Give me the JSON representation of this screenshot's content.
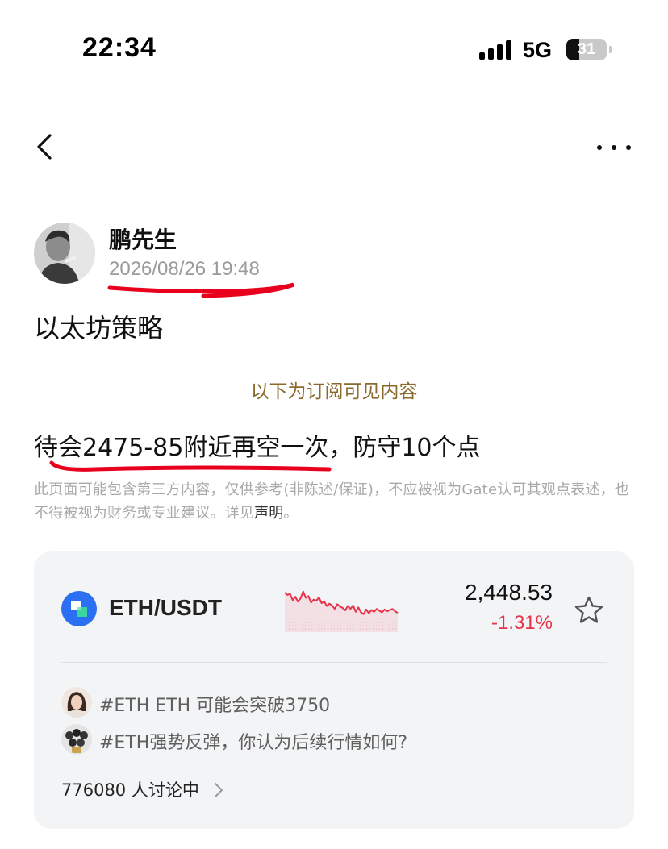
{
  "status_bar": {
    "time": "22:34",
    "network": "5G",
    "battery": "31",
    "battery_level": 0.31
  },
  "nav": {
    "back_icon": "chevron-left-icon",
    "more_icon": "ellipsis-icon"
  },
  "post": {
    "author": "鹏先生",
    "date": "2026/08/26 19:48",
    "title": "以太坊策略",
    "divider_label": "以下为订阅可见内容",
    "content": "待会2475-85附近再空一次，防守10个点",
    "disclaimer_text": "此页面可能包含第三方内容，仅供参考(非陈述/保证)，不应被视为Gate认可其观点表述，也不得被视为财务或专业建议。详见",
    "disclaimer_link": "声明",
    "disclaimer_end": "。",
    "annotation_color": "#e8001c"
  },
  "market_card": {
    "pair": "ETH/USDT",
    "price": "2,448.53",
    "change": "-1.31%",
    "change_color": "#e8334a",
    "sparkline": [
      0.86,
      0.78,
      0.82,
      0.6,
      0.72,
      0.55,
      0.66,
      0.9,
      0.68,
      0.74,
      0.52,
      0.62,
      0.58,
      0.7,
      0.5,
      0.56,
      0.4,
      0.48,
      0.42,
      0.3,
      0.46,
      0.38,
      0.34,
      0.25,
      0.4,
      0.3,
      0.42,
      0.2,
      0.35,
      0.18,
      0.12,
      0.28,
      0.15,
      0.26,
      0.2,
      0.3,
      0.24,
      0.18,
      0.28,
      0.22,
      0.26,
      0.3,
      0.22,
      0.16
    ],
    "star_icon": "star-outline-icon",
    "topics": [
      {
        "text": "#ETH ETH 可能会突破3750"
      },
      {
        "text": "#ETH强势反弹，你认为后续行情如何?"
      }
    ],
    "discussion_count": "776080 人讨论中"
  }
}
